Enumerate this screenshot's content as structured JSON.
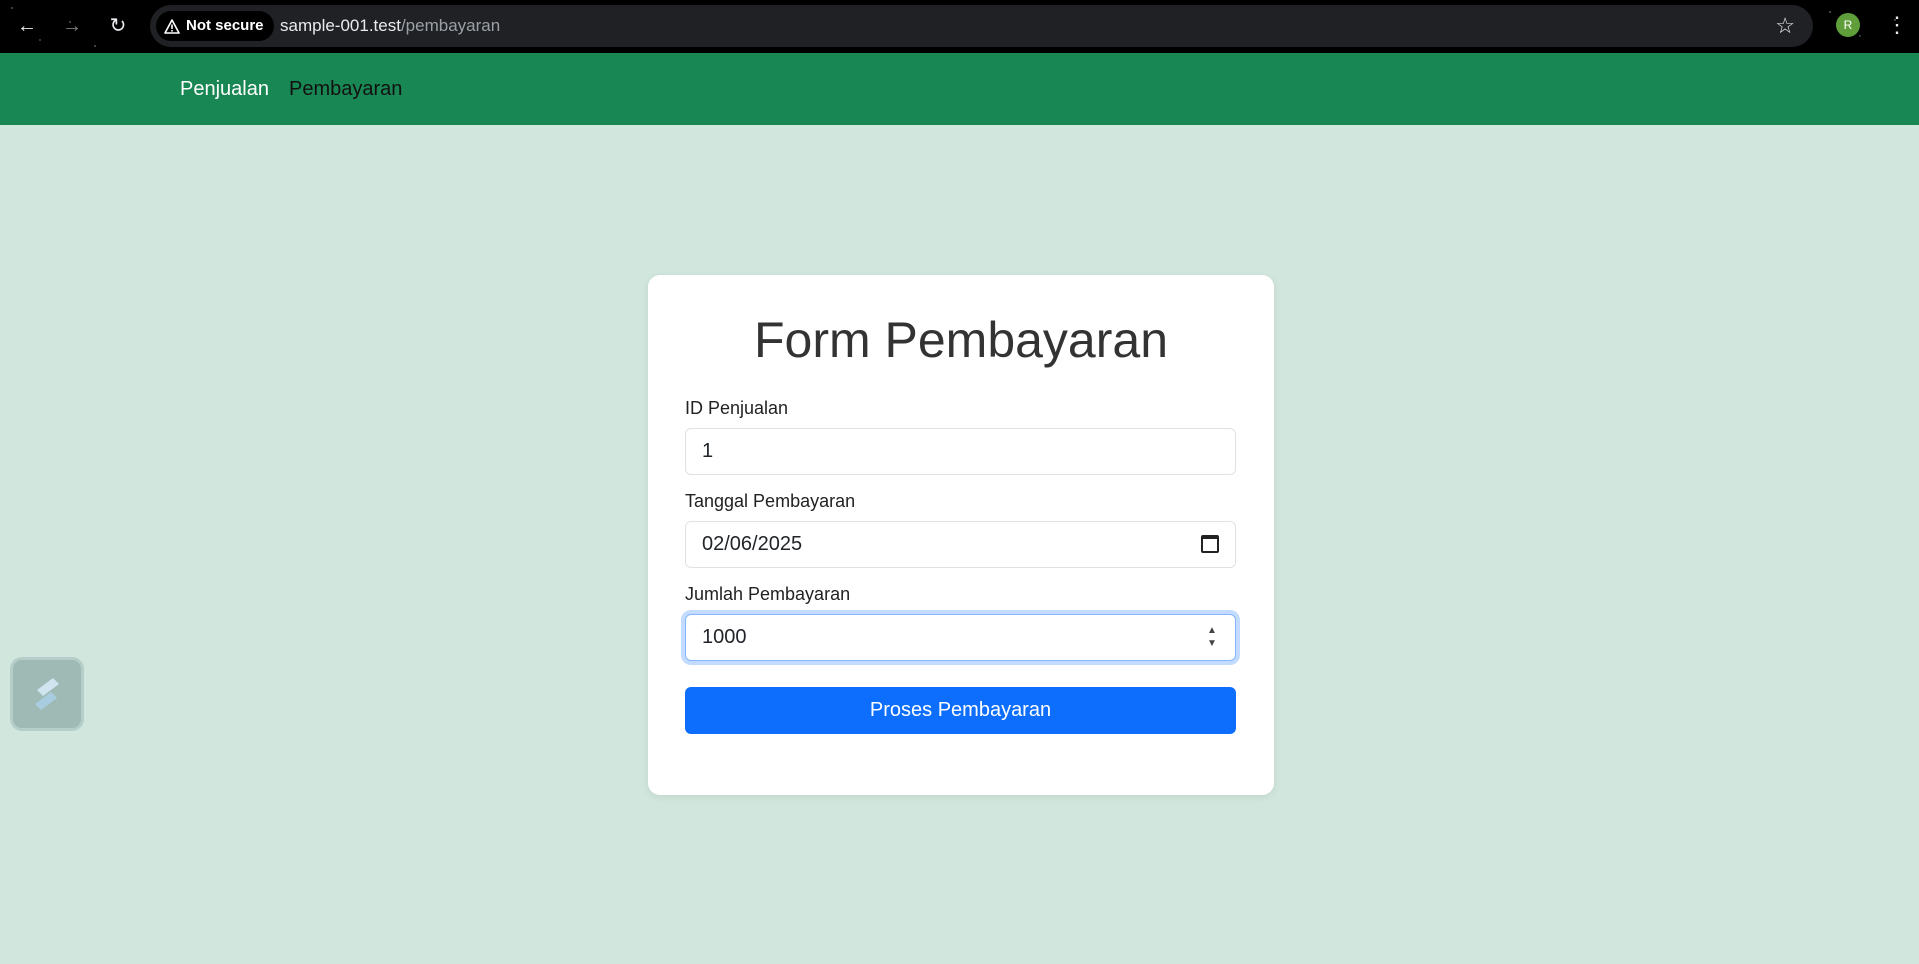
{
  "browser": {
    "security_label": "Not secure",
    "url_host": "sample-001.test",
    "url_path": "/pembayaran",
    "profile_initial": "R"
  },
  "nav": {
    "items": [
      {
        "label": "Penjualan"
      },
      {
        "label": "Pembayaran"
      }
    ]
  },
  "form": {
    "title": "Form Pembayaran",
    "id_label": "ID Penjualan",
    "id_value": "1",
    "date_label": "Tanggal Pembayaran",
    "date_value": "02/06/2025",
    "amount_label": "Jumlah Pembayaran",
    "amount_value": "1000",
    "submit_label": "Proses Pembayaran"
  },
  "colors": {
    "navbar": "#198754",
    "page_bg": "#d1e7dd",
    "button": "#0d6efd"
  }
}
